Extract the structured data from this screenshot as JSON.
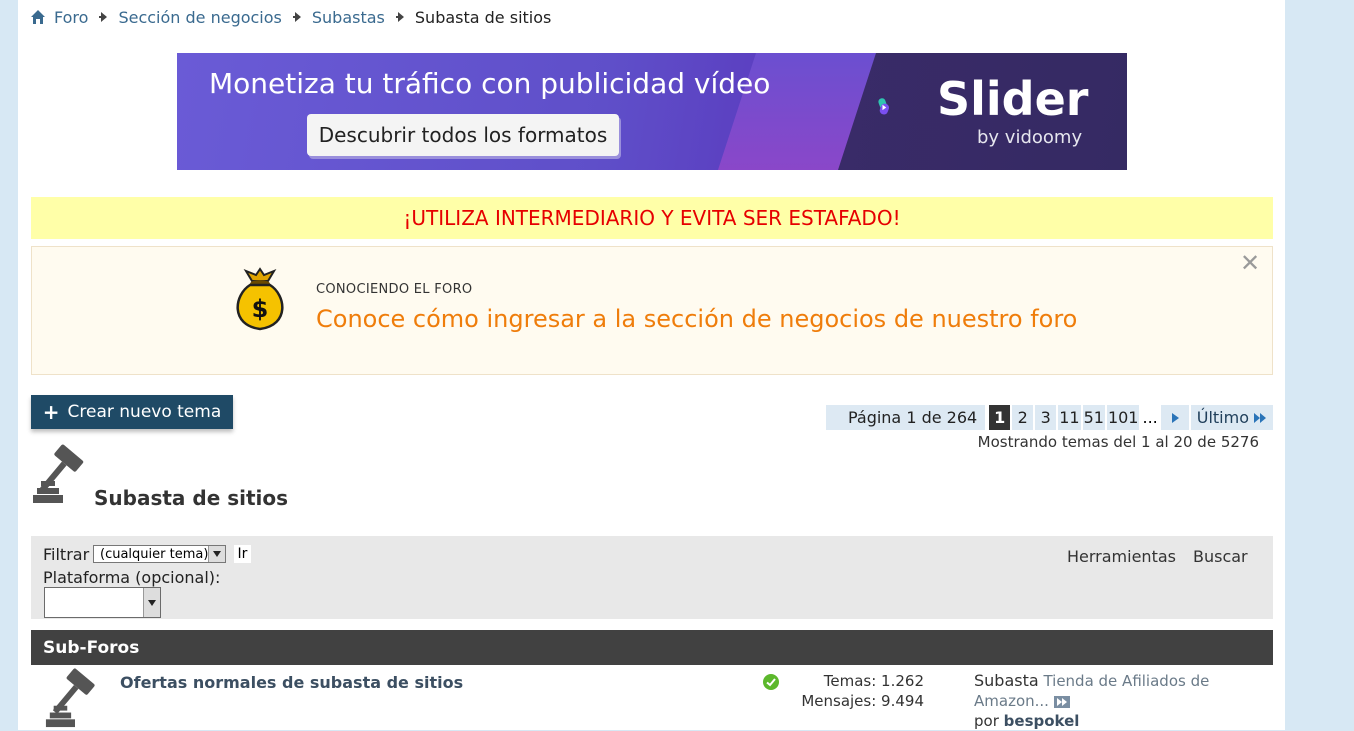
{
  "breadcrumb": {
    "items": [
      "Foro",
      "Sección de negocios",
      "Subastas"
    ],
    "current": "Subasta de sitios"
  },
  "banner": {
    "headline": "Monetiza tu tráfico con publicidad vídeo",
    "cta": "Descubrir todos los formatos",
    "brand": "Slider",
    "by": "by vidoomy"
  },
  "warning": "¡UTILIZA INTERMEDIARIO Y EVITA SER ESTAFADO!",
  "notice": {
    "kicker": "CONOCIENDO EL FORO",
    "heading": "Conoce cómo ingresar a la sección de negocios de nuestro foro"
  },
  "new_thread": {
    "label": "Crear nuevo tema"
  },
  "pagination": {
    "info": "Página 1 de 264",
    "pages": [
      "1",
      "2",
      "3",
      "11",
      "51",
      "101"
    ],
    "ellipsis": "...",
    "last": "Último",
    "showing": "Mostrando temas del 1 al 20 de 5276"
  },
  "forum_title": "Subasta de sitios",
  "filter": {
    "label": "Filtrar",
    "selected": "(cualquier tema)",
    "go": "Ir",
    "platform_label": "Plataforma (opcional):",
    "tools": "Herramientas",
    "search": "Buscar"
  },
  "subforums": {
    "header": "Sub-Foros",
    "rows": [
      {
        "title": "Ofertas normales de subasta de sitios",
        "topics": "Temas: 1.262",
        "messages": "Mensajes: 9.494",
        "last_prefix": "Subasta",
        "last_title": "Tienda de Afiliados de Amazon...",
        "by": "por",
        "author": "bespokel"
      }
    ]
  },
  "colors": {
    "page_bg": "#d7e8f4",
    "header_dark": "#1f4a66",
    "warning_bg": "#ffffa8",
    "warning_text": "#e60000",
    "notice_heading": "#ef7d0b",
    "subforum_header": "#414141"
  }
}
